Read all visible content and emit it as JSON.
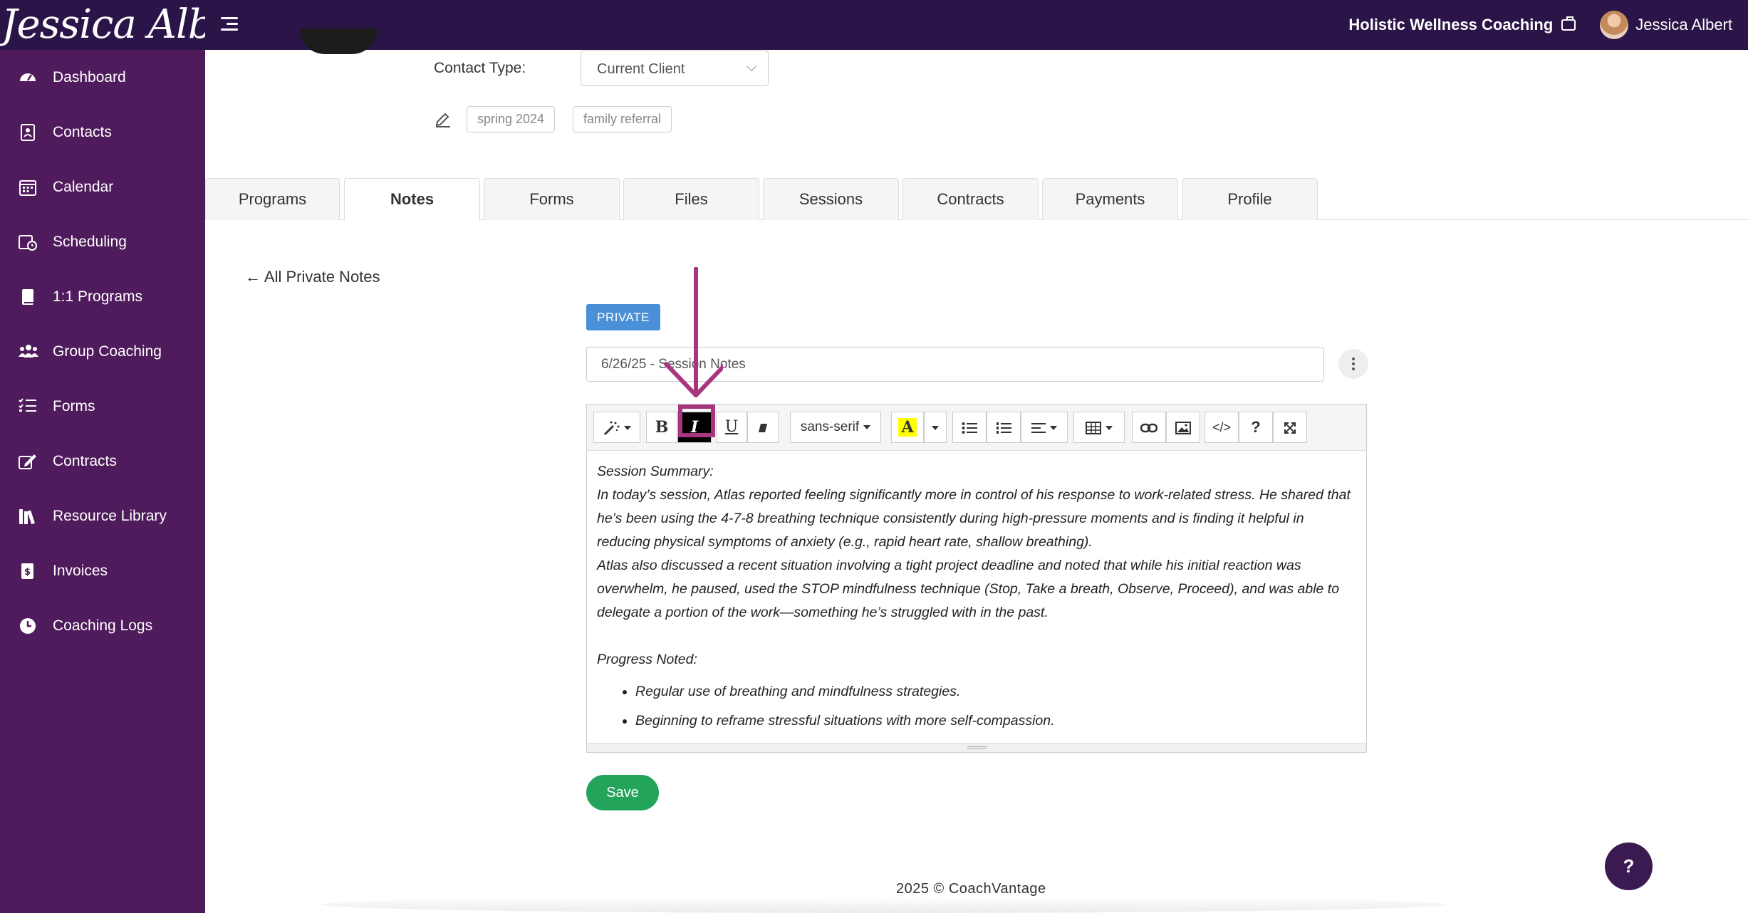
{
  "header": {
    "brand_script": "Jessica Albert",
    "business_name": "Holistic Wellness Coaching",
    "user_name": "Jessica Albert"
  },
  "sidebar": {
    "items": [
      {
        "label": "Dashboard",
        "icon": "dashboard-icon"
      },
      {
        "label": "Contacts",
        "icon": "contacts-icon"
      },
      {
        "label": "Calendar",
        "icon": "calendar-icon"
      },
      {
        "label": "Scheduling",
        "icon": "scheduling-icon"
      },
      {
        "label": "1:1 Programs",
        "icon": "book-icon"
      },
      {
        "label": "Group Coaching",
        "icon": "group-icon"
      },
      {
        "label": "Forms",
        "icon": "list-icon"
      },
      {
        "label": "Contracts",
        "icon": "signature-icon"
      },
      {
        "label": "Resource Library",
        "icon": "library-icon"
      },
      {
        "label": "Invoices",
        "icon": "invoice-icon"
      },
      {
        "label": "Coaching Logs",
        "icon": "clock-icon"
      }
    ]
  },
  "contact": {
    "type_label": "Contact Type:",
    "type_value": "Current Client",
    "tags": [
      "spring 2024",
      "family referral"
    ]
  },
  "tabs": [
    {
      "label": "Programs",
      "active": false
    },
    {
      "label": "Notes",
      "active": true
    },
    {
      "label": "Forms",
      "active": false
    },
    {
      "label": "Files",
      "active": false
    },
    {
      "label": "Sessions",
      "active": false
    },
    {
      "label": "Contracts",
      "active": false
    },
    {
      "label": "Payments",
      "active": false
    },
    {
      "label": "Profile",
      "active": false
    }
  ],
  "notes": {
    "back_link": "All Private Notes",
    "privacy_badge": "PRIVATE",
    "title_value": "6/26/25 - Session Notes",
    "toolbar": {
      "font_name": "sans-serif",
      "highlight_color": "#ffff00",
      "active_button": "italic"
    },
    "body": {
      "summary_heading": "Session Summary:",
      "paragraph1": "In today’s session, Atlas reported feeling significantly more in control of his response to work-related stress. He shared that he’s been using the 4-7-8 breathing technique consistently during high-pressure moments and is finding it helpful in reducing physical symptoms of anxiety (e.g., rapid heart rate, shallow breathing).",
      "paragraph2": "Atlas also discussed a recent situation involving a tight project deadline and noted that while his initial reaction was overwhelm, he paused, used the STOP mindfulness technique (Stop, Take a breath, Observe, Proceed), and was able to delegate a portion of the work—something he’s struggled with in the past.",
      "progress_heading": "Progress Noted:",
      "progress_items": [
        "Regular use of breathing and mindfulness strategies.",
        "Beginning to reframe stressful situations with more self-compassion."
      ]
    },
    "save_label": "Save"
  },
  "footer": {
    "text": "2025 © CoachVantage"
  },
  "help_button": {
    "label": "?"
  },
  "colors": {
    "topbar": "#2b1548",
    "sidebar": "#4f1b5c",
    "badge": "#4a90d9",
    "save": "#22a45a",
    "annotation": "#a8367f"
  }
}
